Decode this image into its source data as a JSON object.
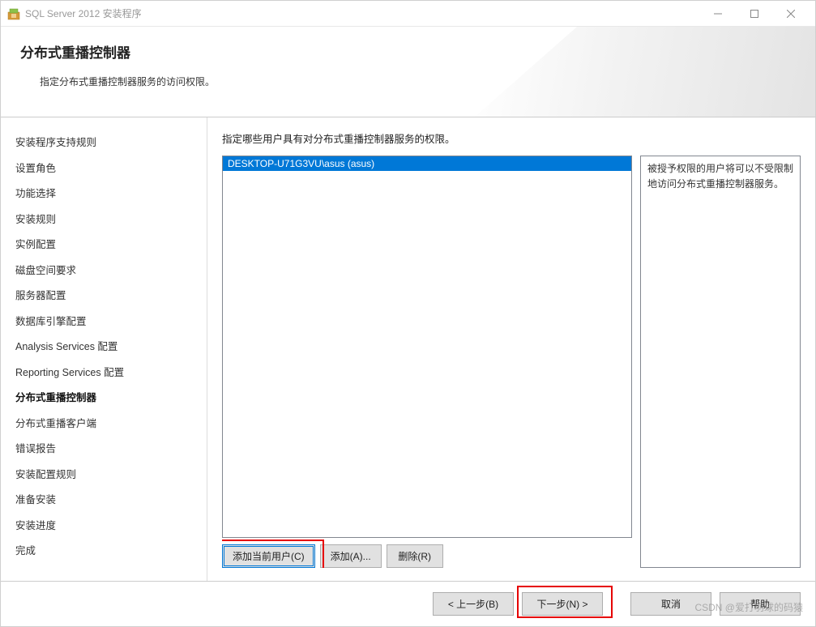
{
  "titlebar": {
    "title": "SQL Server 2012 安装程序"
  },
  "header": {
    "title": "分布式重播控制器",
    "subtitle": "指定分布式重播控制器服务的访问权限。"
  },
  "sidebar": {
    "items": [
      {
        "label": "安装程序支持规则",
        "active": false
      },
      {
        "label": "设置角色",
        "active": false
      },
      {
        "label": "功能选择",
        "active": false
      },
      {
        "label": "安装规则",
        "active": false
      },
      {
        "label": "实例配置",
        "active": false
      },
      {
        "label": "磁盘空间要求",
        "active": false
      },
      {
        "label": "服务器配置",
        "active": false
      },
      {
        "label": "数据库引擎配置",
        "active": false
      },
      {
        "label": "Analysis Services 配置",
        "active": false
      },
      {
        "label": "Reporting Services 配置",
        "active": false
      },
      {
        "label": "分布式重播控制器",
        "active": true
      },
      {
        "label": "分布式重播客户端",
        "active": false
      },
      {
        "label": "错误报告",
        "active": false
      },
      {
        "label": "安装配置规则",
        "active": false
      },
      {
        "label": "准备安装",
        "active": false
      },
      {
        "label": "安装进度",
        "active": false
      },
      {
        "label": "完成",
        "active": false
      }
    ]
  },
  "main": {
    "instruction": "指定哪些用户具有对分布式重播控制器服务的权限。",
    "users": [
      "DESKTOP-U71G3VU\\asus (asus)"
    ],
    "buttons": {
      "add_current": "添加当前用户(C)",
      "add": "添加(A)...",
      "remove": "删除(R)"
    },
    "info": "被授予权限的用户将可以不受限制地访问分布式重播控制器服务。"
  },
  "footer": {
    "back": "< 上一步(B)",
    "next": "下一步(N) >",
    "cancel": "取消",
    "help": "帮助"
  },
  "watermark": "CSDN @爱打羽球的码猿"
}
